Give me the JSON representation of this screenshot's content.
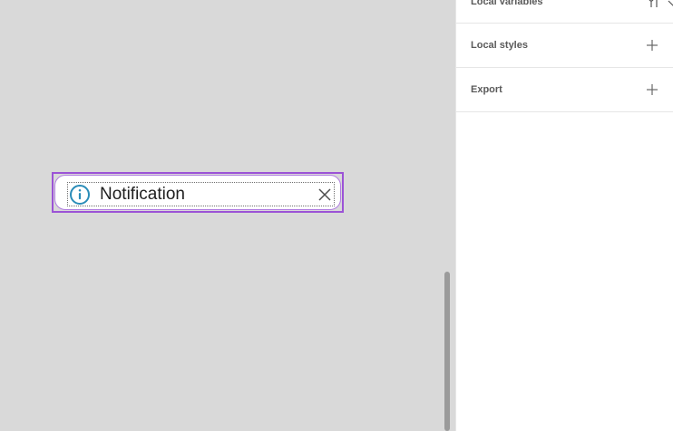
{
  "canvas": {
    "notification": {
      "text": "Notification",
      "icon": "info-icon",
      "close_icon": "close-icon",
      "border_color": "#9b53d6",
      "icon_color": "#2a8cb8"
    }
  },
  "panel": {
    "rows": [
      {
        "label": "Local variables",
        "icon": "variables-adjust-icon"
      },
      {
        "label": "Local styles",
        "icon": "plus-icon"
      },
      {
        "label": "Export",
        "icon": "plus-icon"
      }
    ]
  }
}
